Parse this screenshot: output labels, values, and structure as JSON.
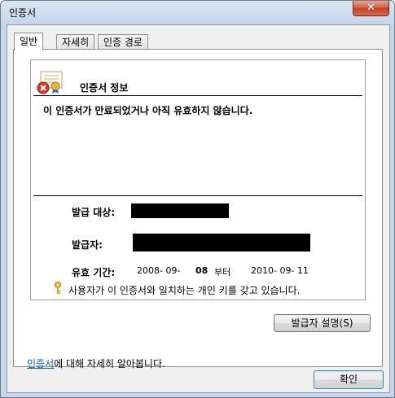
{
  "window": {
    "title": "인증서",
    "close_glyph": "✕"
  },
  "tabs": [
    {
      "label": "일반"
    },
    {
      "label": "자세히"
    },
    {
      "label": "인증 경로"
    }
  ],
  "general": {
    "info_title": "인증서 정보",
    "warning": "이 인증서가 만료되었거나 아직 유효하지 않습니다.",
    "issued_to_label": "발급 대상:",
    "issued_by_label": "발급자:",
    "validity": {
      "label": "유효 기간:",
      "from": "2008-  09-",
      "from_day": "08",
      "until_word": "부터",
      "to": "2010-  09-   11"
    },
    "private_key_note": "사용자가 이 인증서와 일치하는 개인 키를 갖고 있습니다.",
    "issuer_statement_button": "발급자 설명(S)",
    "learn_more_link": "인증서",
    "learn_more_text": "에 대해 자세히 알아봅니다."
  },
  "footer": {
    "ok_button": "확인"
  },
  "icons": {
    "certificate": "certificate-icon",
    "error_badge": "error-badge-icon",
    "key": "key-icon"
  }
}
